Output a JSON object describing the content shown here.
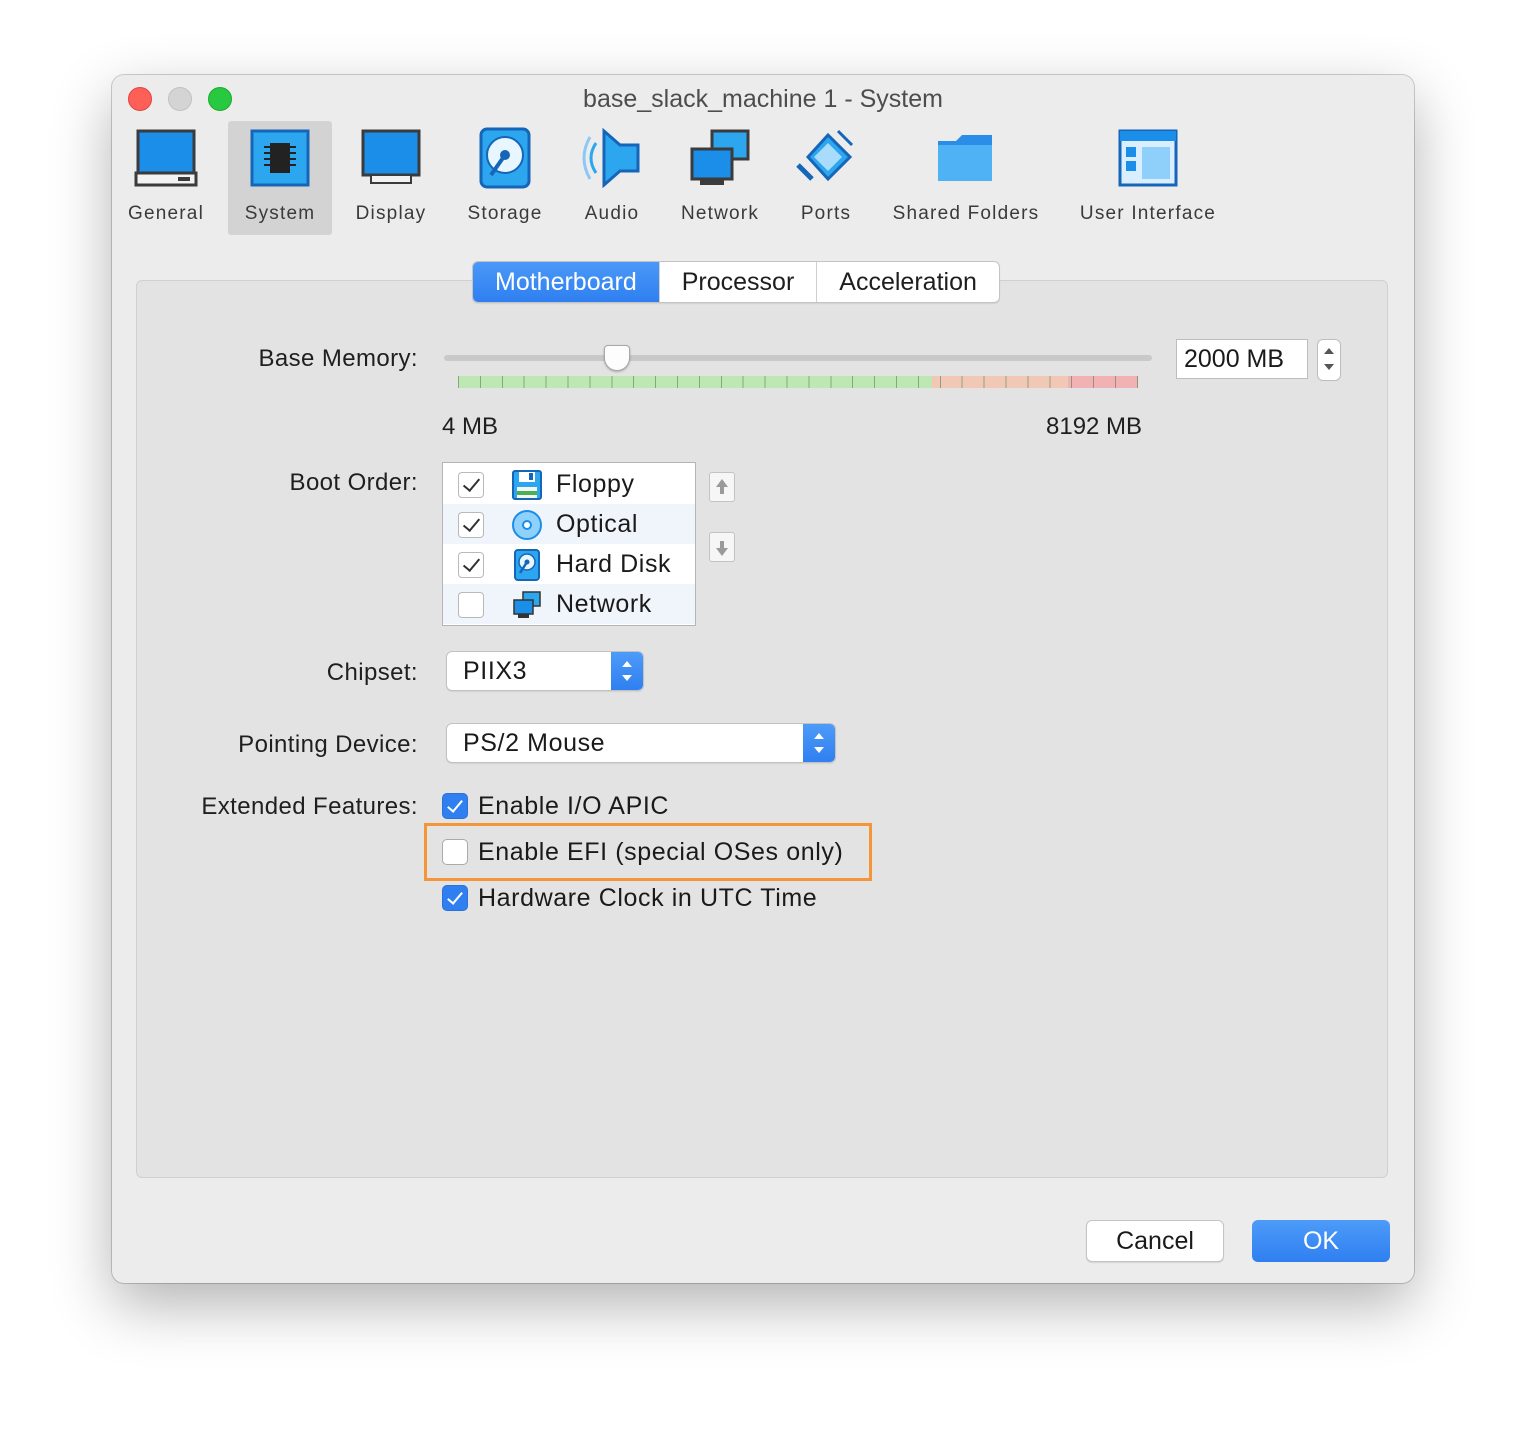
{
  "window": {
    "title": "base_slack_machine 1 - System"
  },
  "toolbar": {
    "items": [
      {
        "label": "General",
        "icon": "general-icon"
      },
      {
        "label": "System",
        "icon": "system-icon",
        "selected": true
      },
      {
        "label": "Display",
        "icon": "display-icon"
      },
      {
        "label": "Storage",
        "icon": "storage-icon"
      },
      {
        "label": "Audio",
        "icon": "audio-icon"
      },
      {
        "label": "Network",
        "icon": "network-icon"
      },
      {
        "label": "Ports",
        "icon": "ports-icon"
      },
      {
        "label": "Shared Folders",
        "icon": "shared-folders-icon"
      },
      {
        "label": "User Interface",
        "icon": "user-interface-icon"
      }
    ]
  },
  "tabs": [
    {
      "label": "Motherboard",
      "active": true
    },
    {
      "label": "Processor"
    },
    {
      "label": "Acceleration"
    }
  ],
  "base_memory": {
    "label": "Base Memory:",
    "value": "2000 MB",
    "min_label": "4 MB",
    "max_label": "8192 MB",
    "min_mb": 4,
    "max_mb": 8192,
    "current_mb": 2000
  },
  "boot_order": {
    "label": "Boot Order:",
    "items": [
      {
        "name": "Floppy",
        "checked": true,
        "icon": "floppy-icon"
      },
      {
        "name": "Optical",
        "checked": true,
        "icon": "optical-disc-icon"
      },
      {
        "name": "Hard Disk",
        "checked": true,
        "icon": "hard-disk-icon"
      },
      {
        "name": "Network",
        "checked": false,
        "icon": "network-icon"
      }
    ]
  },
  "chipset": {
    "label": "Chipset:",
    "value": "PIIX3"
  },
  "pointing_device": {
    "label": "Pointing Device:",
    "value": "PS/2 Mouse"
  },
  "extended_features": {
    "label": "Extended Features:",
    "items": [
      {
        "label": "Enable I/O APIC",
        "checked": true
      },
      {
        "label": "Enable EFI (special OSes only)",
        "checked": false,
        "highlighted": true
      },
      {
        "label": "Hardware Clock in UTC Time",
        "checked": true
      }
    ]
  },
  "buttons": {
    "cancel": "Cancel",
    "ok": "OK"
  },
  "colors": {
    "accent": "#2f7ff1",
    "highlight": "#f4953a",
    "window_bg": "#ececec",
    "panel_bg": "#e3e3e3"
  }
}
